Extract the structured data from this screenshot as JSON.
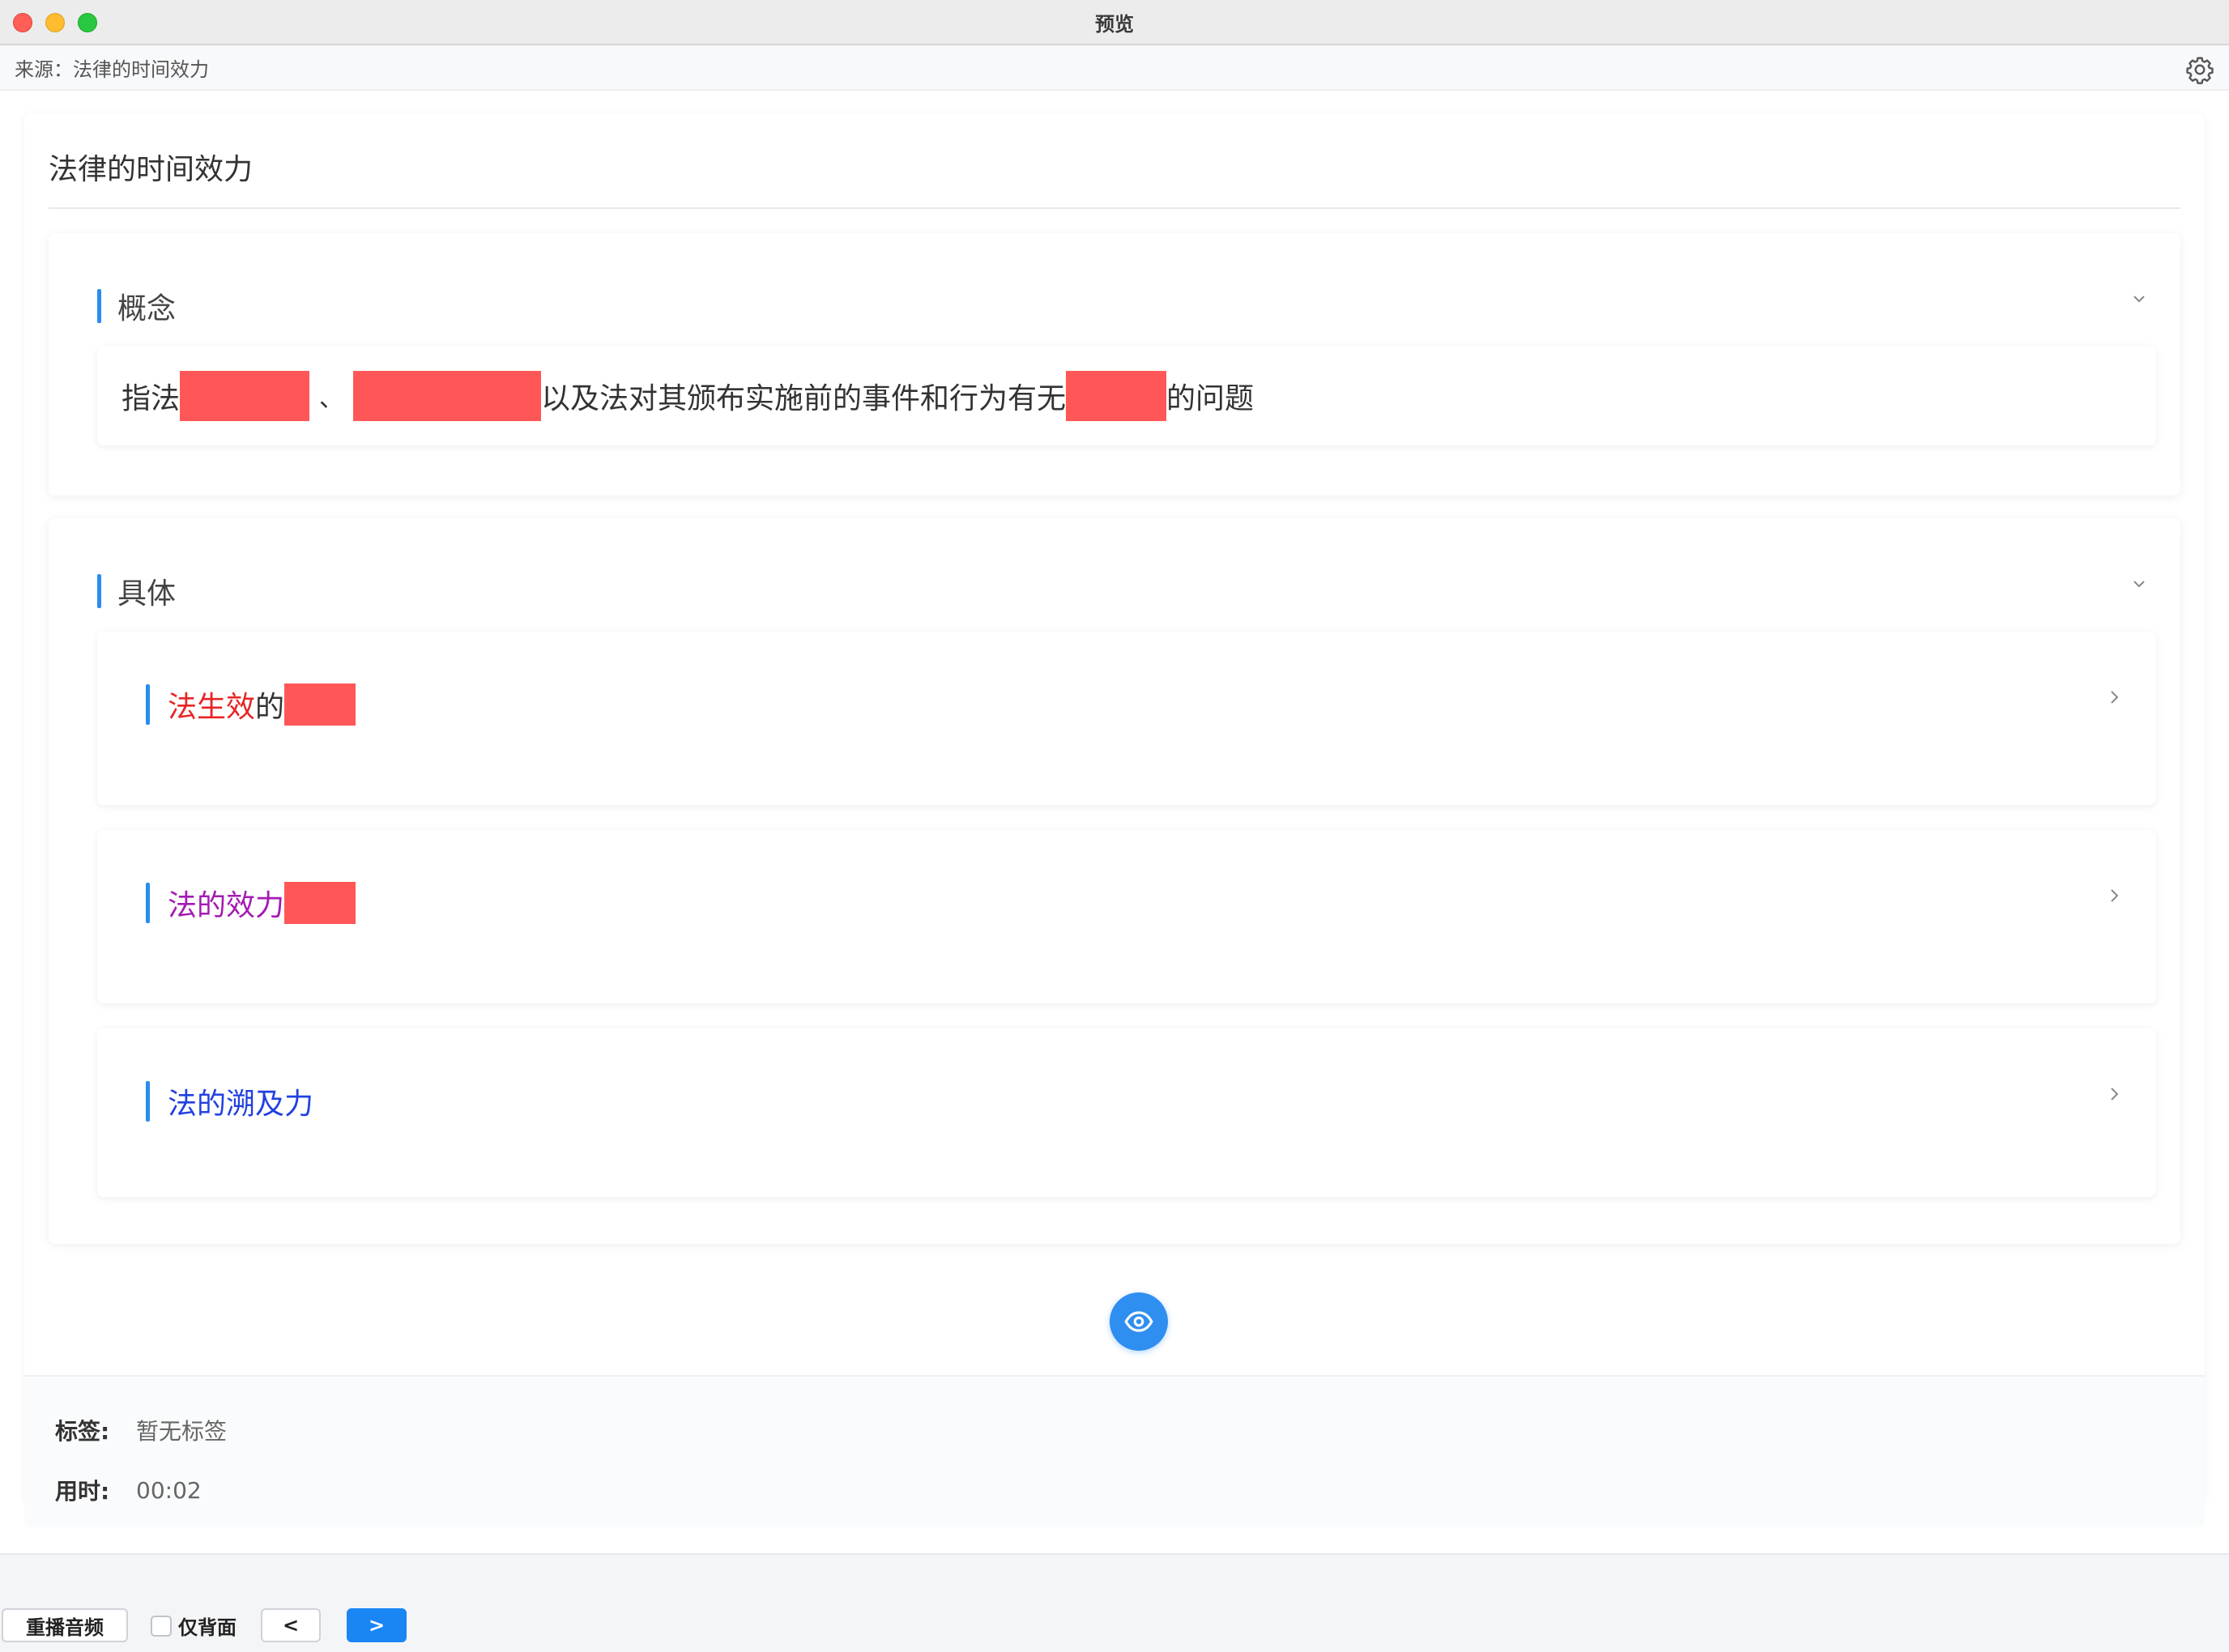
{
  "window": {
    "title": "预览"
  },
  "source": {
    "text": "来源：法律的时间效力"
  },
  "card": {
    "title": "法律的时间效力"
  },
  "concept": {
    "label": "概念",
    "text_prefix": "指法",
    "separator": "、",
    "text_middle": "以及法对其颁布实施前的事件和行为有无",
    "text_suffix": "的问题"
  },
  "specific": {
    "label": "具体",
    "items": [
      {
        "label_colored": "法生效",
        "label_rest": "的",
        "color": "#e82424"
      },
      {
        "label_colored": "法的效力",
        "label_rest": "",
        "color": "#a31bb3"
      },
      {
        "label_colored": "法的溯及力",
        "label_rest": "",
        "color": "#2240e0"
      }
    ]
  },
  "meta": {
    "tags_key": "标签:",
    "tags_value": "暂无标签",
    "time_key": "用时:",
    "time_value": "00:02"
  },
  "footer": {
    "replay_label": "重播音频",
    "back_only_label": "仅背面",
    "prev_label": "<",
    "next_label": ">"
  },
  "colors": {
    "accent": "#2a8cf0",
    "mask": "#ff5757",
    "primary_button": "#1a86f3"
  }
}
